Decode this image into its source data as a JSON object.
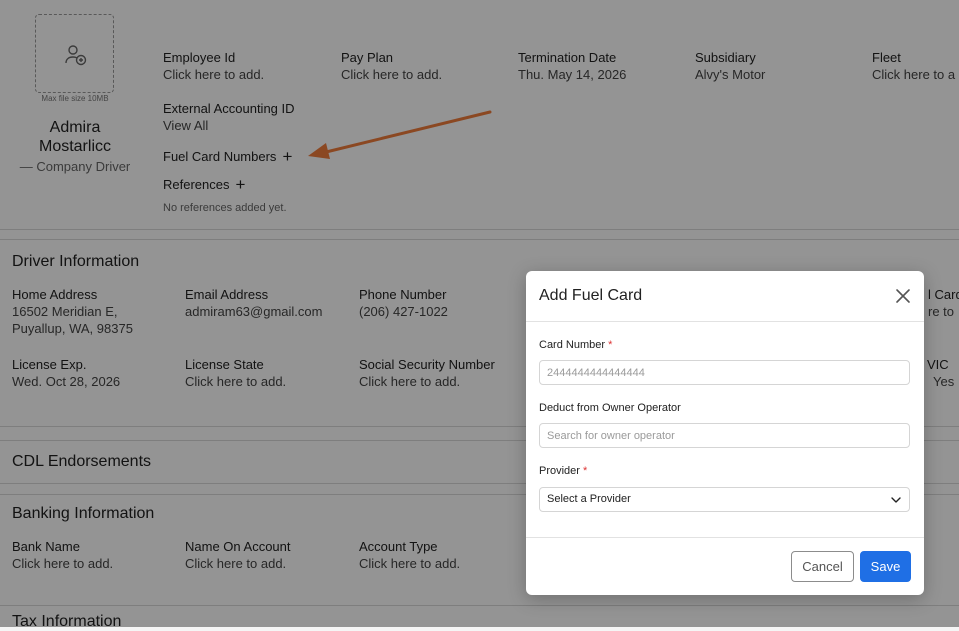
{
  "profile": {
    "max_file_size": "Max file size 10MB",
    "first_name": "Admira",
    "last_name": "Mostarlicc",
    "role": "— Company Driver"
  },
  "header_fields": [
    {
      "label": "Employee Id",
      "value": "Click here to add."
    },
    {
      "label": "Pay Plan",
      "value": "Click here to add."
    },
    {
      "label": "Termination Date",
      "value": "Thu. May 14, 2026"
    },
    {
      "label": "Subsidiary",
      "value": "Alvy's Motor"
    },
    {
      "label": "Fleet",
      "value": "Click here to a"
    },
    {
      "label": "External Accounting ID",
      "value": "View All"
    }
  ],
  "fuel_card_numbers_label": "Fuel Card Numbers",
  "references_label": "References",
  "no_references_text": "No references added yet.",
  "driver_info": {
    "title": "Driver Information",
    "fields": [
      {
        "label": "Home Address",
        "value": "16502 Meridian E,",
        "value2": "Puyallup, WA, 98375"
      },
      {
        "label": "Email Address",
        "value": "admiram63@gmail.com"
      },
      {
        "label": "Phone Number",
        "value": "(206) 427-1022"
      },
      {
        "label": "l Card",
        "value": "re to"
      },
      {
        "label": "License Exp.",
        "value": "Wed. Oct 28, 2026"
      },
      {
        "label": "License State",
        "value": "Click here to add."
      },
      {
        "label": "Social Security Number",
        "value": "Click here to add."
      },
      {
        "label": "VIC",
        "value": "Yes"
      }
    ]
  },
  "cdl": {
    "title": "CDL Endorsements"
  },
  "banking": {
    "title": "Banking Information",
    "fields": [
      {
        "label": "Bank Name",
        "value": "Click here to add."
      },
      {
        "label": "Name On Account",
        "value": "Click here to add."
      },
      {
        "label": "Account Type",
        "value": "Click here to add."
      }
    ]
  },
  "tax": {
    "title": "Tax Information"
  },
  "modal": {
    "title": "Add Fuel Card",
    "card_number_label": "Card Number",
    "required_mark": "*",
    "card_number_placeholder": "2444444444444444",
    "deduct_label": "Deduct from Owner Operator",
    "deduct_placeholder": "Search for owner operator",
    "provider_label": "Provider",
    "provider_selected": "Select a Provider",
    "cancel_label": "Cancel",
    "save_label": "Save"
  },
  "colors": {
    "arrow": "#f07c3c",
    "primary": "#1f6fe5",
    "required": "#d33333"
  }
}
